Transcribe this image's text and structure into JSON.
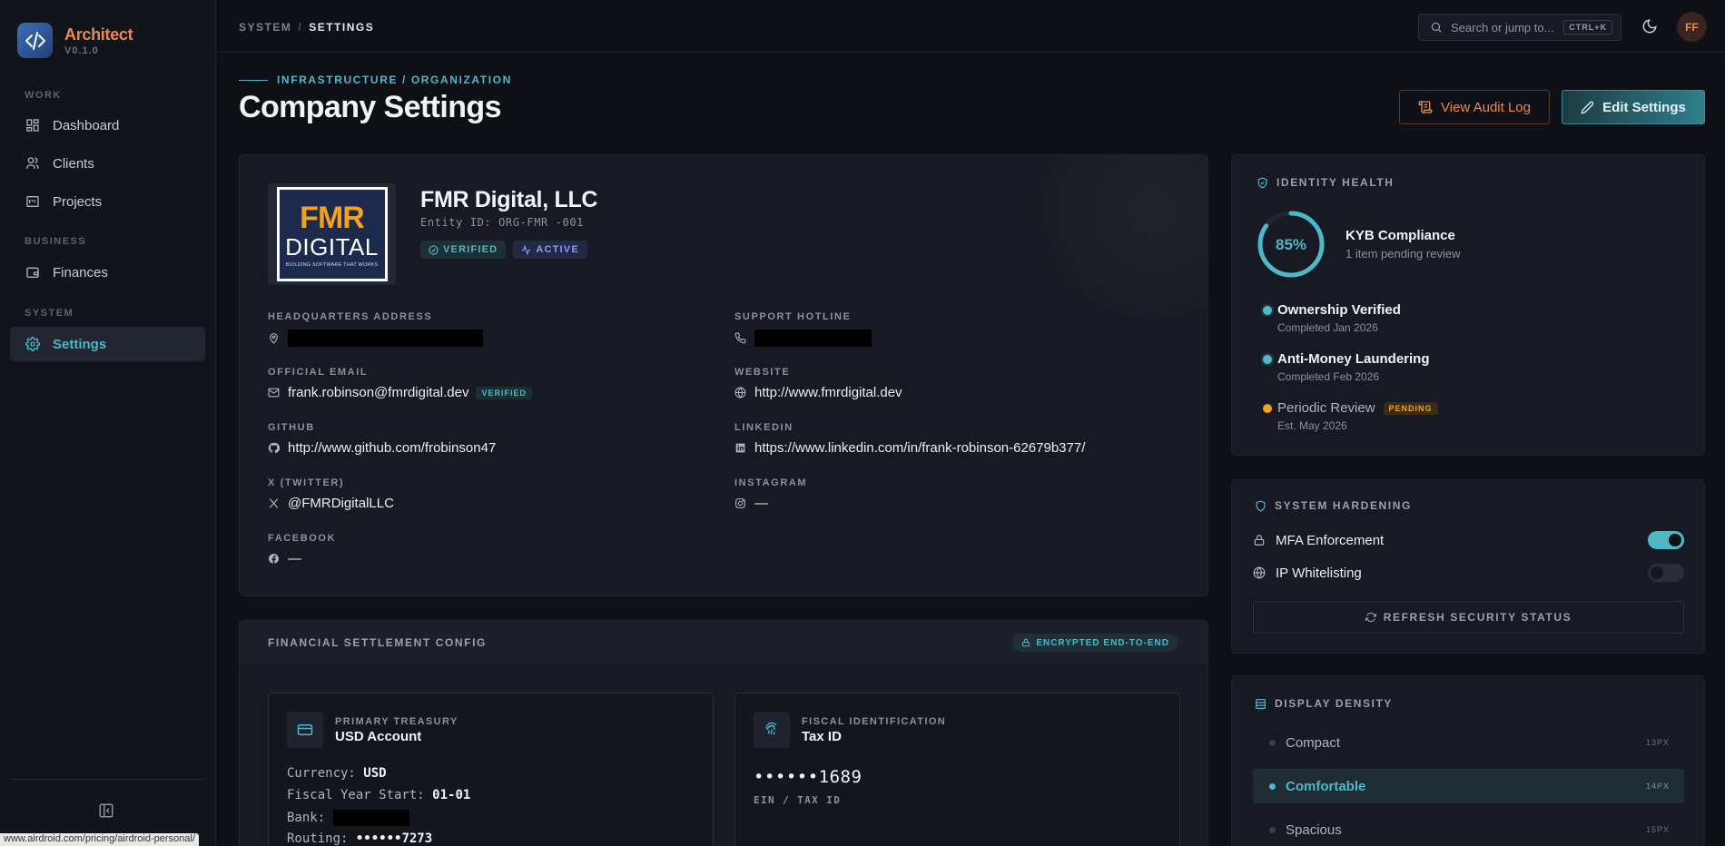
{
  "app": {
    "name": "Architect",
    "version": "V0.1.0"
  },
  "sidebar": {
    "sections": [
      "WORK",
      "BUSINESS",
      "SYSTEM"
    ],
    "items": [
      {
        "label": "Dashboard",
        "icon": "dashboard-icon"
      },
      {
        "label": "Clients",
        "icon": "users-icon"
      },
      {
        "label": "Projects",
        "icon": "projects-icon"
      },
      {
        "label": "Finances",
        "icon": "wallet-icon"
      },
      {
        "label": "Settings",
        "icon": "gear-icon",
        "active": true
      }
    ]
  },
  "status_url": "www.airdroid.com/pricing/airdroid-personal/",
  "header": {
    "breadcrumb": [
      "SYSTEM",
      "SETTINGS"
    ],
    "search_placeholder": "Search or jump to...",
    "shortcut": "CTRL+K",
    "avatar_initials": "FF"
  },
  "page": {
    "eyebrow": "INFRASTRUCTURE / ORGANIZATION",
    "title": "Company Settings",
    "audit_button": "View Audit Log",
    "edit_button": "Edit Settings"
  },
  "company": {
    "logo": {
      "line1": "FMR",
      "line2": "DIGITAL",
      "tagline": "BUILDING SOFTWARE THAT WORKS"
    },
    "name": "FMR Digital, LLC",
    "entity_id": "Entity ID: ORG-FMR -001",
    "badges": [
      "VERIFIED",
      "ACTIVE"
    ],
    "fields": {
      "hq_label": "HEADQUARTERS ADDRESS",
      "support_label": "SUPPORT HOTLINE",
      "email_label": "OFFICIAL EMAIL",
      "email": "frank.robinson@fmrdigital.dev",
      "email_badge": "VERIFIED",
      "website_label": "WEBSITE",
      "website": "http://www.fmrdigital.dev",
      "github_label": "GITHUB",
      "github": "http://www.github.com/frobinson47",
      "linkedin_label": "LINKEDIN",
      "linkedin": "https://www.linkedin.com/in/frank-robinson-62679b377/",
      "twitter_label": "X (TWITTER)",
      "twitter": "@FMRDigitalLLC",
      "instagram_label": "INSTAGRAM",
      "instagram": "—",
      "facebook_label": "FACEBOOK",
      "facebook": "—"
    }
  },
  "financial": {
    "title": "FINANCIAL SETTLEMENT CONFIG",
    "encrypted_badge": "ENCRYPTED END-TO-END",
    "treasury": {
      "eyebrow": "PRIMARY TREASURY",
      "title": "USD Account",
      "currency_label": "Currency:",
      "currency": "USD",
      "fy_label": "Fiscal Year Start:",
      "fy": "01-01",
      "bank_label": "Bank:",
      "routing_label": "Routing:",
      "routing": "••••••7273"
    },
    "fiscal": {
      "eyebrow": "FISCAL IDENTIFICATION",
      "title": "Tax ID",
      "value": "••••••1689",
      "label": "EIN / TAX ID"
    }
  },
  "identity_health": {
    "title": "IDENTITY HEALTH",
    "percent_label": "85%",
    "percent": 85,
    "kyb_title": "KYB Compliance",
    "kyb_sub": "1 item pending review",
    "steps": [
      {
        "title": "Ownership Verified",
        "sub": "Completed Jan 2026",
        "status": "done"
      },
      {
        "title": "Anti-Money Laundering",
        "sub": "Completed Feb 2026",
        "status": "done"
      },
      {
        "title": "Periodic Review",
        "sub": "Est. May 2026",
        "status": "pending",
        "tag": "PENDING"
      }
    ]
  },
  "hardening": {
    "title": "SYSTEM HARDENING",
    "mfa_label": "MFA Enforcement",
    "mfa_on": true,
    "ip_label": "IP Whitelisting",
    "ip_on": false,
    "refresh_button": "REFRESH SECURITY STATUS"
  },
  "density": {
    "title": "DISPLAY DENSITY",
    "options": [
      {
        "label": "Compact",
        "size": "13PX"
      },
      {
        "label": "Comfortable",
        "size": "14PX",
        "selected": true
      },
      {
        "label": "Spacious",
        "size": "15PX"
      }
    ]
  },
  "colors": {
    "accent": "#4fb8c8",
    "brand": "#ea8a52",
    "pending": "#f4a11d",
    "background": "#0e1016"
  }
}
